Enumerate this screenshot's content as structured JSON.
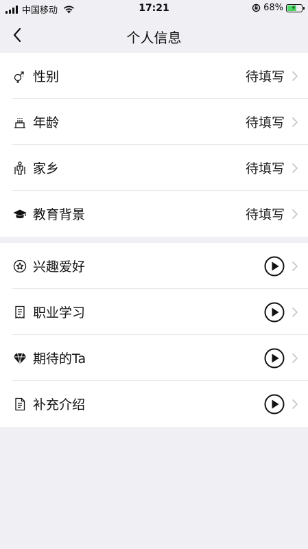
{
  "status_bar": {
    "carrier": "中国移动",
    "time": "17:21",
    "battery": "68%",
    "battery_level": 0.68
  },
  "nav": {
    "title": "个人信息"
  },
  "basic_info": [
    {
      "label": "性别",
      "value": "待填写",
      "icon": "gender-icon"
    },
    {
      "label": "年龄",
      "value": "待填写",
      "icon": "cake-icon"
    },
    {
      "label": "家乡",
      "value": "待填写",
      "icon": "person-icon"
    },
    {
      "label": "教育背景",
      "value": "待填写",
      "icon": "graduation-cap-icon"
    }
  ],
  "intro_items": [
    {
      "label": "兴趣爱好",
      "icon": "star-circle-icon"
    },
    {
      "label": "职业学习",
      "icon": "receipt-icon"
    },
    {
      "label": "期待的Ta",
      "icon": "diamond-icon"
    },
    {
      "label": "补充介绍",
      "icon": "document-icon"
    }
  ],
  "colors": {
    "background": "#efeff4",
    "card": "#ffffff",
    "chevron": "#c7c7cc",
    "battery_green": "#4cd964"
  }
}
